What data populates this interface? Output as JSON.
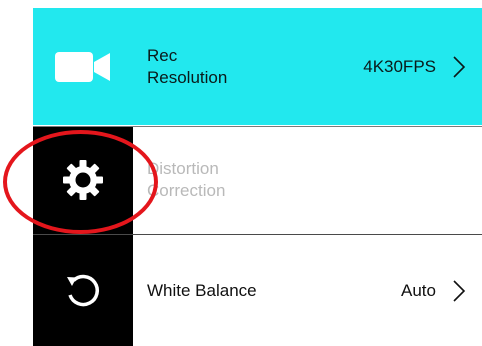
{
  "menu": {
    "rec_resolution": {
      "label_line1": "Rec",
      "label_line2": "Resolution",
      "value": "4K30FPS",
      "icon": "video-camera-icon"
    },
    "distortion_correction": {
      "label_line1": "Distortion",
      "label_line2": "Correction",
      "icon": "gear-icon"
    },
    "white_balance": {
      "label": "White Balance",
      "value": "Auto",
      "icon": "reset-icon"
    }
  },
  "colors": {
    "accent": "#22e8ee",
    "sidebar": "#000000",
    "highlight_ring": "#e4161c",
    "disabled_text": "#b9b9b9"
  }
}
